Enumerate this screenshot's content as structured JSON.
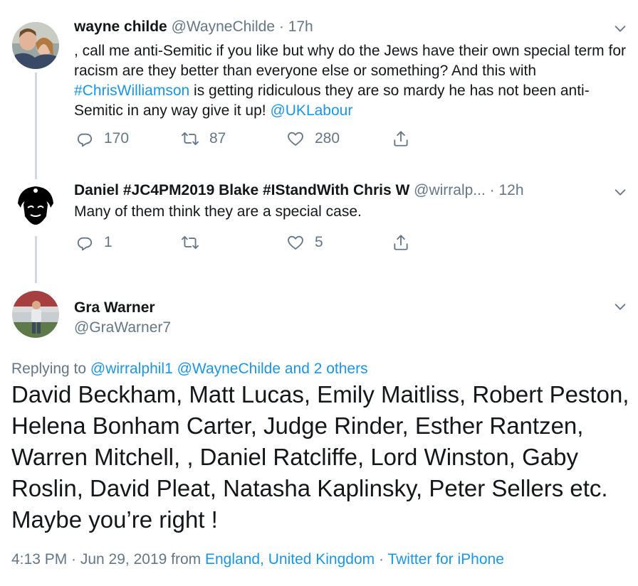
{
  "tweet1": {
    "name": "wayne childe",
    "handle": "@WayneChilde",
    "dot": "·",
    "time": "17h",
    "text_a": ", call me anti-Semitic if you like but why do the Jews have their own special term for racism are they better than everyone else or something? And this with ",
    "hashtag": "#ChrisWilliamson",
    "text_b": " is getting ridiculous they are so mardy he has not been anti-Semitic in any way give it up! ",
    "mention": "@UKLabour",
    "replies": "170",
    "retweets": "87",
    "likes": "280"
  },
  "tweet2": {
    "name": "Daniel #JC4PM2019 Blake #IStandWith Chris W",
    "handle": "@wirralp...",
    "dot": "·",
    "time": "12h",
    "text": "Many of them think they are a special case.",
    "replies": "1",
    "retweets": "",
    "likes": "5"
  },
  "main": {
    "name": "Gra Warner",
    "handle": "@GraWarner7",
    "replying_prefix": "Replying to",
    "replying_users": "@wirralphil1 @WayneChilde and 2 others",
    "text": "David Beckham, Matt Lucas, Emily Maitliss, Robert Peston, Helena Bonham Carter, Judge Rinder, Esther Rantzen, Warren Mitchell, , Daniel Ratcliffe, Lord Winston, Gaby Roslin, David Pleat, Natasha Kaplinsky, Peter Sellers etc.  Maybe you’re right !",
    "time": "4:13 PM · Jun 29, 2019 from",
    "location": "England, United Kingdom",
    "sep": "·",
    "source": "Twitter for iPhone"
  },
  "colors": {
    "link": "#1b95e0",
    "muted": "#657786",
    "text": "#14171a",
    "thread": "#cfd9de"
  },
  "icons": [
    "reply-icon",
    "retweet-icon",
    "like-icon",
    "share-icon",
    "chevron-down-icon"
  ]
}
